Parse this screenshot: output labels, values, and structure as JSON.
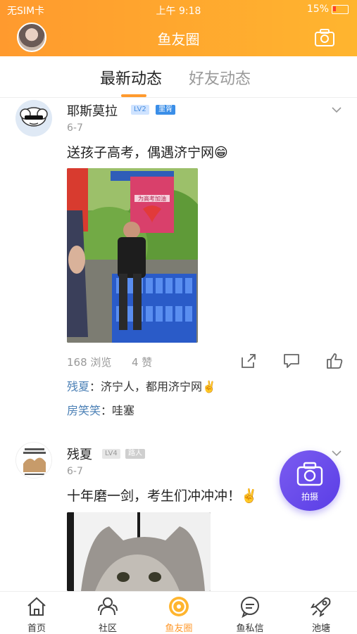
{
  "status_bar": {
    "carrier": "无SIM卡",
    "time": "上午 9:18",
    "battery": "15%"
  },
  "header": {
    "title": "鱼友圈"
  },
  "tabs": [
    {
      "label": "最新动态"
    },
    {
      "label": "好友动态"
    }
  ],
  "posts": [
    {
      "username": "耶斯莫拉",
      "level": "LV2",
      "role": "里胥",
      "date": "6-7",
      "content": "送孩子高考，偶遇济宁网😁",
      "photo_sign_text": "为高考加油",
      "views": "168 浏览",
      "likes": "4 赞",
      "comments": [
        {
          "author": "残夏",
          "text": "济宁人，都用济宁网✌️"
        },
        {
          "author": "房笑笑",
          "text": "哇塞"
        }
      ]
    },
    {
      "username": "残夏",
      "level": "LV4",
      "role": "路人",
      "date": "6-7",
      "content": "十年磨一剑，考生们冲冲冲！✌️"
    }
  ],
  "fab": {
    "label": "拍摄"
  },
  "bottom_nav": [
    {
      "label": "首页",
      "icon": "home-icon"
    },
    {
      "label": "社区",
      "icon": "community-icon"
    },
    {
      "label": "鱼友圈",
      "icon": "fish-circle-icon",
      "active": true
    },
    {
      "label": "鱼私信",
      "icon": "message-icon"
    },
    {
      "label": "池塘",
      "icon": "rocket-icon"
    }
  ],
  "colors": {
    "accent": "#ff9a2e",
    "link": "#4a7fb5",
    "fab": "#6a4cec"
  }
}
